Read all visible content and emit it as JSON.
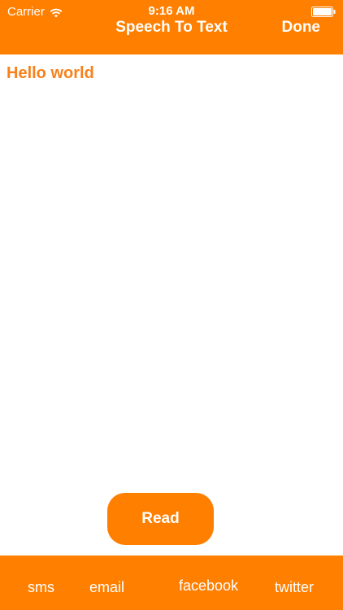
{
  "status_bar": {
    "carrier": "Carrier",
    "time": "9:16 AM",
    "wifi_icon": "wifi-icon",
    "battery_icon": "battery-icon"
  },
  "nav": {
    "title": "Speech To Text",
    "done_label": "Done"
  },
  "content": {
    "text": "Hello world"
  },
  "actions": {
    "read_label": "Read"
  },
  "share": {
    "sms": "sms",
    "email": "email",
    "facebook": "facebook",
    "twitter": "twitter"
  },
  "colors": {
    "accent": "#ff7f00",
    "text_accent": "#f7811c",
    "background": "#ffffff"
  }
}
